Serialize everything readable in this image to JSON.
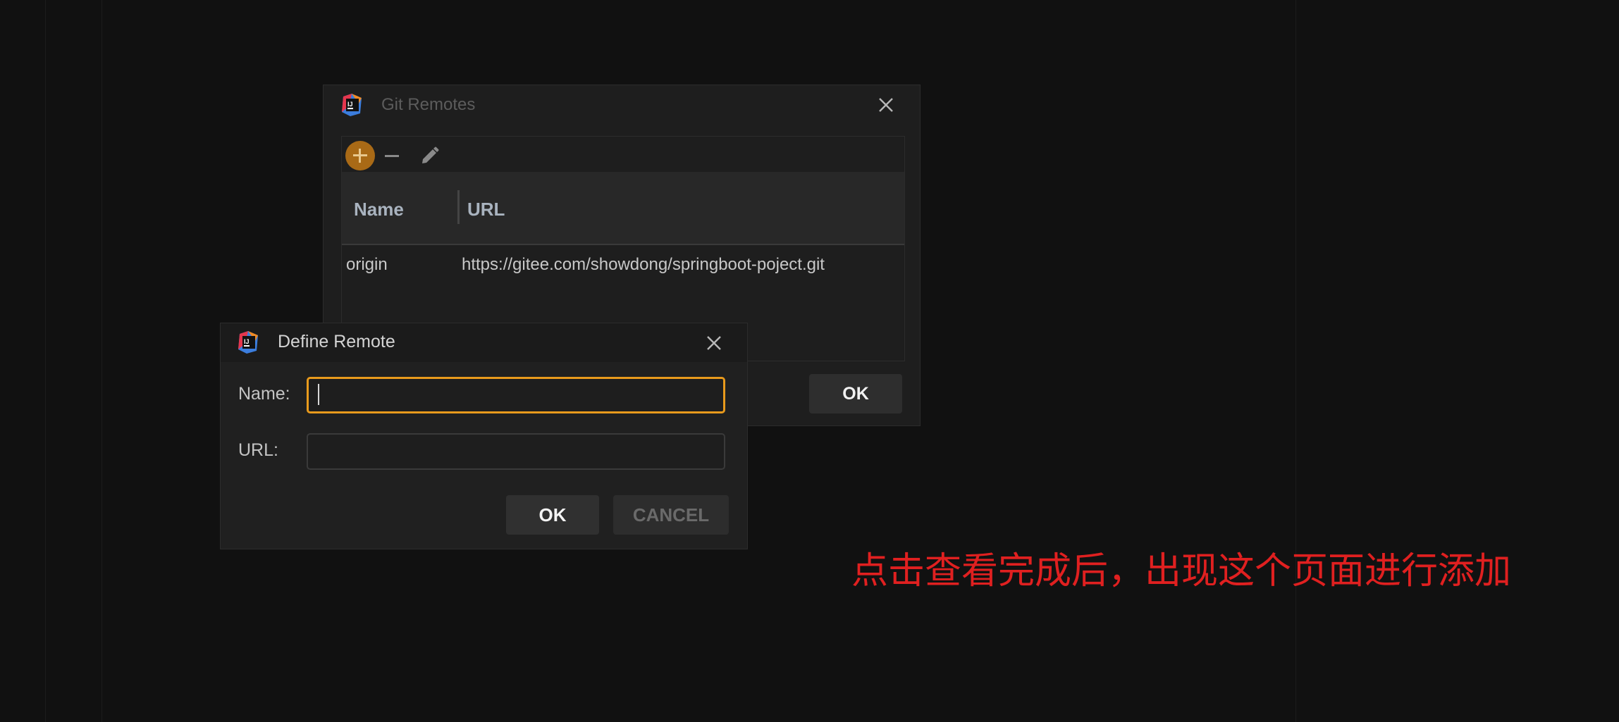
{
  "git_remotes_dialog": {
    "title": "Git Remotes",
    "toolbar": {
      "add_icon": "plus-icon",
      "remove_icon": "minus-icon",
      "edit_icon": "pencil-icon"
    },
    "table": {
      "columns": [
        "Name",
        "URL"
      ],
      "rows": [
        {
          "name": "origin",
          "url": "https://gitee.com/showdong/springboot-poject.git"
        }
      ]
    },
    "ok_label": "OK"
  },
  "define_remote_dialog": {
    "title": "Define Remote",
    "name_label": "Name:",
    "name_value": "",
    "url_label": "URL:",
    "url_value": "",
    "ok_label": "OK",
    "cancel_label": "CANCEL"
  },
  "annotation_text": "点击查看完成后，出现这个页面进行添加",
  "colors": {
    "accent": "#e89a1c",
    "add_button": "#a96a16",
    "annotation": "#e02020",
    "background": "#111111"
  }
}
